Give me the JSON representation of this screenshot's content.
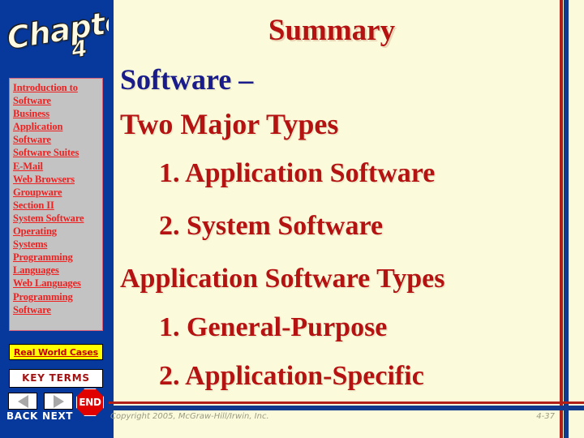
{
  "slide": {
    "background_color": "#fbfbdc",
    "title": "Summary",
    "title_color": "#b51212"
  },
  "sidebar": {
    "background_color": "#07399c",
    "chapter_label": "Chapter",
    "chapter_number": "4",
    "nav_items": [
      {
        "label": "Introduction to"
      },
      {
        "label": "Software"
      },
      {
        "label": "Business"
      },
      {
        "label": "Application"
      },
      {
        "label": "Software"
      },
      {
        "label": "Software Suites"
      },
      {
        "label": "E-Mail"
      },
      {
        "label": "Web Browsers"
      },
      {
        "label": "Groupware"
      },
      {
        "label": "Section II"
      },
      {
        "label": "System Software"
      },
      {
        "label": "Operating"
      },
      {
        "label": "Systems"
      },
      {
        "label": "Programming"
      },
      {
        "label": "Languages"
      },
      {
        "label": "Web Languages"
      },
      {
        "label": "Programming"
      },
      {
        "label": "Software"
      }
    ],
    "real_world_cases": "Real World Cases",
    "key_terms": "KEY TERMS",
    "back_label": "BACK",
    "next_label": "NEXT",
    "end_label": "END"
  },
  "body": {
    "lines": [
      {
        "text": "Software –",
        "color": "navy",
        "indent": "none"
      },
      {
        "text": "Two Major Types",
        "color": "red",
        "indent": "none"
      },
      {
        "text": "1. Application Software",
        "color": "red",
        "indent": "sub"
      },
      {
        "text": "2. System Software",
        "color": "red",
        "indent": "sub"
      },
      {
        "text": "Application Software Types",
        "color": "red",
        "indent": "none"
      },
      {
        "text": "1. General-Purpose",
        "color": "red",
        "indent": "sub"
      },
      {
        "text": "2. Application-Specific",
        "color": "red",
        "indent": "sub"
      }
    ]
  },
  "footer": {
    "copyright": "Copyright 2005, McGraw-Hill/Irwin, Inc.",
    "page_number": "4-37"
  }
}
